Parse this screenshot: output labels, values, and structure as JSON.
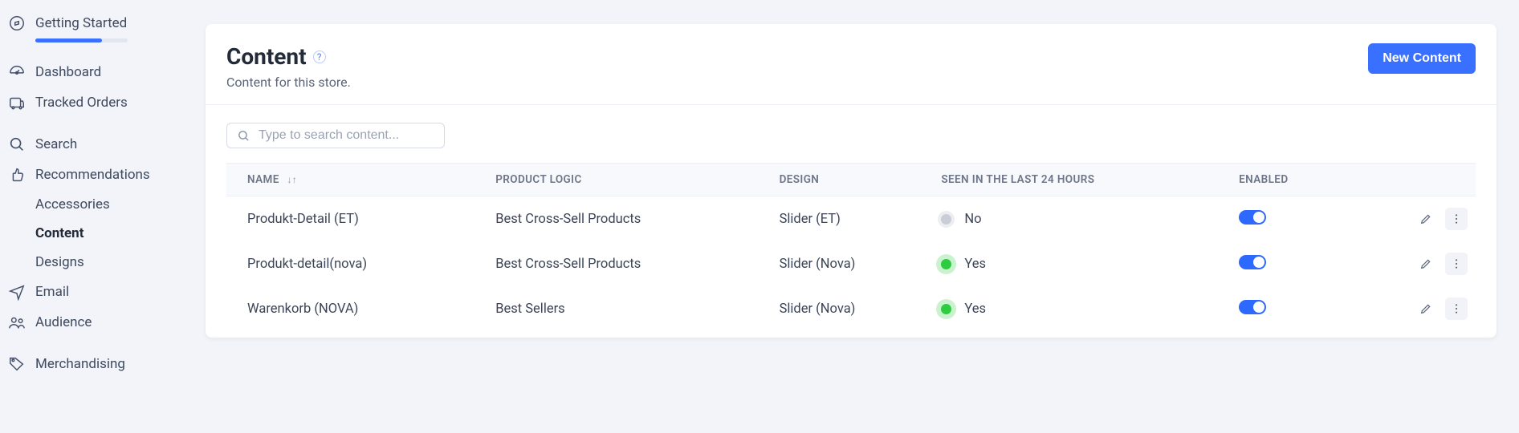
{
  "sidebar": {
    "items": [
      {
        "label": "Getting Started",
        "icon": "compass-icon",
        "hasProgress": true
      },
      {
        "label": "Dashboard",
        "icon": "dashboard-icon"
      },
      {
        "label": "Tracked Orders",
        "icon": "orders-icon"
      },
      {
        "label": "Search",
        "icon": "search-icon"
      },
      {
        "label": "Recommendations",
        "icon": "thumbs-up-icon",
        "children": [
          {
            "label": "Accessories"
          },
          {
            "label": "Content",
            "active": true
          },
          {
            "label": "Designs"
          }
        ]
      },
      {
        "label": "Email",
        "icon": "send-icon"
      },
      {
        "label": "Audience",
        "icon": "audience-icon"
      },
      {
        "label": "Merchandising",
        "icon": "tag-icon"
      }
    ],
    "progress_percent": 72
  },
  "header": {
    "title": "Content",
    "subtitle": "Content for this store.",
    "new_button": "New Content",
    "help_label": "?"
  },
  "search": {
    "placeholder": "Type to search content..."
  },
  "table": {
    "columns": {
      "name": "Name",
      "product_logic": "Product Logic",
      "design": "Design",
      "seen": "Seen in the last 24 hours",
      "enabled": "Enabled"
    },
    "rows": [
      {
        "name": "Produkt-Detail (ET)",
        "logic": "Best Cross-Sell Products",
        "design": "Slider (ET)",
        "seen": "No",
        "seen_state": "gray",
        "enabled": true
      },
      {
        "name": "Produkt-detail(nova)",
        "logic": "Best Cross-Sell Products",
        "design": "Slider (Nova)",
        "seen": "Yes",
        "seen_state": "green",
        "enabled": true
      },
      {
        "name": "Warenkorb (NOVA)",
        "logic": "Best Sellers",
        "design": "Slider (Nova)",
        "seen": "Yes",
        "seen_state": "green",
        "enabled": true
      }
    ]
  }
}
